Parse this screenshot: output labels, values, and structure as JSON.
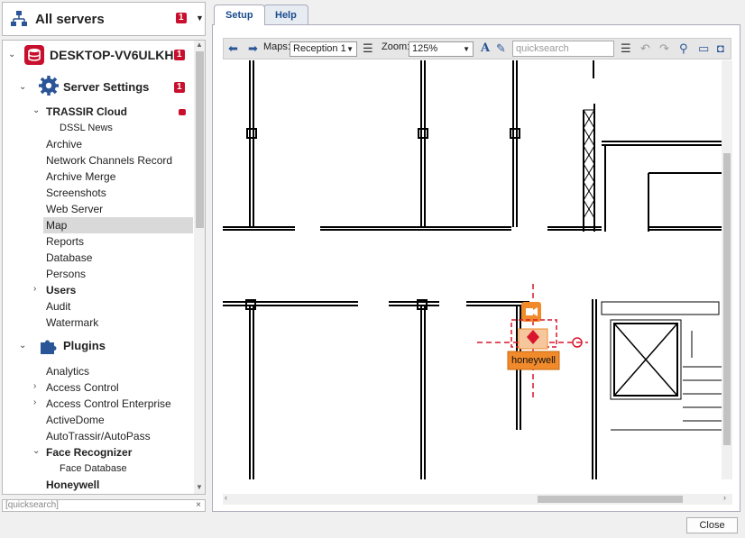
{
  "header": {
    "title": "All servers",
    "badge": "1"
  },
  "tree": {
    "server": {
      "label": "DESKTOP-VV6ULKH",
      "badge": "1"
    },
    "settings": {
      "label": "Server Settings",
      "badge": "1"
    },
    "items": [
      {
        "label": "TRASSIR Cloud",
        "bold": true
      },
      {
        "label": "DSSL News"
      },
      {
        "label": "Archive"
      },
      {
        "label": "Network Channels Record"
      },
      {
        "label": "Archive Merge"
      },
      {
        "label": "Screenshots"
      },
      {
        "label": "Web Server"
      },
      {
        "label": "Map",
        "selected": true
      },
      {
        "label": "Reports"
      },
      {
        "label": "Database"
      },
      {
        "label": "Persons"
      },
      {
        "label": "Users",
        "bold": true
      },
      {
        "label": "Audit"
      },
      {
        "label": "Watermark"
      }
    ],
    "plugins": {
      "label": "Plugins"
    },
    "plugin_items": [
      {
        "label": "Analytics"
      },
      {
        "label": "Access Control"
      },
      {
        "label": "Access Control Enterprise"
      },
      {
        "label": "ActiveDome"
      },
      {
        "label": "AutoTrassir/AutoPass"
      },
      {
        "label": "Face Recognizer"
      },
      {
        "label": "Face Database"
      },
      {
        "label": "Honeywell"
      }
    ]
  },
  "left_search": {
    "placeholder": "[quicksearch]",
    "clear": "×"
  },
  "tabs": [
    {
      "label": "Setup",
      "active": true
    },
    {
      "label": "Help"
    }
  ],
  "toolbar": {
    "maps_label": "Maps:",
    "maps_value": "Reception 1",
    "zoom_label": "Zoom:",
    "zoom_value": "125%",
    "search_placeholder": "quicksearch"
  },
  "map": {
    "device_label": "honeywell",
    "accent": "#f08a2a",
    "marker": "#d9162c"
  },
  "footer": {
    "close_label": "Close"
  },
  "colors": {
    "badge": "#c8102e",
    "link_blue": "#1a4b8c",
    "icon_blue": "#2a5596"
  }
}
